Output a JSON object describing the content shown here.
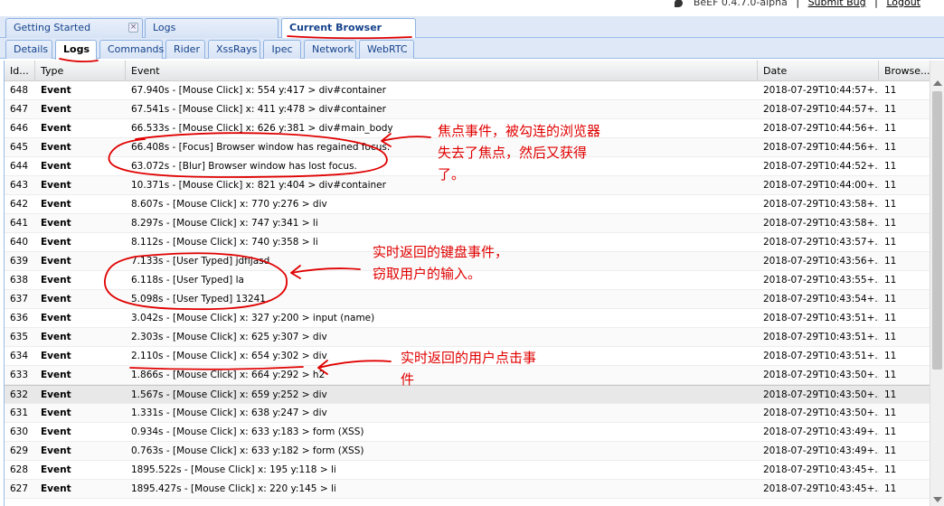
{
  "topbar": {
    "app_version": "BeEF  0.4.7.0-alpha",
    "submit_bug": "Submit  Bug",
    "logout": "Logout",
    "separator": "|"
  },
  "outer_tabs": [
    {
      "label": "Getting Started"
    },
    {
      "label": "Logs"
    },
    {
      "label": "Current Browser"
    }
  ],
  "inner_tabs": [
    {
      "label": "Details"
    },
    {
      "label": "Logs"
    },
    {
      "label": "Commands"
    },
    {
      "label": "Rider"
    },
    {
      "label": "XssRays"
    },
    {
      "label": "Ipec"
    },
    {
      "label": "Network"
    },
    {
      "label": "WebRTC"
    }
  ],
  "grid": {
    "columns": [
      "Id...",
      "Type",
      "Event",
      "Date",
      "Browse..."
    ],
    "rows": [
      [
        "648",
        "Event",
        "67.940s - [Mouse Click] x: 554 y:417 > div#container",
        "2018-07-29T10:44:57+...",
        "11"
      ],
      [
        "647",
        "Event",
        "67.541s - [Mouse Click] x: 411 y:478 > div#container",
        "2018-07-29T10:44:57+...",
        "11"
      ],
      [
        "646",
        "Event",
        "66.533s - [Mouse Click] x: 626 y:381 > div#main_body",
        "2018-07-29T10:44:56+...",
        "11"
      ],
      [
        "645",
        "Event",
        "66.408s - [Focus] Browser window has regained focus.",
        "2018-07-29T10:44:56+...",
        "11"
      ],
      [
        "644",
        "Event",
        "63.072s - [Blur] Browser window has lost focus.",
        "2018-07-29T10:44:52+...",
        "11"
      ],
      [
        "643",
        "Event",
        "10.371s - [Mouse Click] x: 821 y:404 > div#container",
        "2018-07-29T10:44:00+...",
        "11"
      ],
      [
        "642",
        "Event",
        "8.607s - [Mouse Click] x: 770 y:276 > div",
        "2018-07-29T10:43:58+...",
        "11"
      ],
      [
        "641",
        "Event",
        "8.297s - [Mouse Click] x: 747 y:341 > li",
        "2018-07-29T10:43:58+...",
        "11"
      ],
      [
        "640",
        "Event",
        "8.112s - [Mouse Click] x: 740 y:358 > li",
        "2018-07-29T10:43:57+...",
        "11"
      ],
      [
        "639",
        "Event",
        "7.133s - [User Typed] jdfljasd",
        "2018-07-29T10:43:56+...",
        "11"
      ],
      [
        "638",
        "Event",
        "6.118s - [User Typed] la",
        "2018-07-29T10:43:55+...",
        "11"
      ],
      [
        "637",
        "Event",
        "5.098s - [User Typed] 13241",
        "2018-07-29T10:43:54+...",
        "11"
      ],
      [
        "636",
        "Event",
        "3.042s - [Mouse Click] x: 327 y:200 > input (name)",
        "2018-07-29T10:43:51+...",
        "11"
      ],
      [
        "635",
        "Event",
        "2.303s - [Mouse Click] x: 625 y:307 > div",
        "2018-07-29T10:43:51+...",
        "11"
      ],
      [
        "634",
        "Event",
        "2.110s - [Mouse Click] x: 654 y:302 > div",
        "2018-07-29T10:43:51+...",
        "11"
      ],
      [
        "633",
        "Event",
        "1.866s - [Mouse Click] x: 664 y:292 > h2",
        "2018-07-29T10:43:50+...",
        "11"
      ],
      [
        "632",
        "Event",
        "1.567s - [Mouse Click] x: 659 y:252 > div",
        "2018-07-29T10:43:50+...",
        "11"
      ],
      [
        "631",
        "Event",
        "1.331s - [Mouse Click] x: 638 y:247 > div",
        "2018-07-29T10:43:50+...",
        "11"
      ],
      [
        "630",
        "Event",
        "0.934s - [Mouse Click] x: 633 y:183 > form (XSS)",
        "2018-07-29T10:43:49+...",
        "11"
      ],
      [
        "629",
        "Event",
        "0.763s - [Mouse Click] x: 633 y:182 > form (XSS)",
        "2018-07-29T10:43:49+...",
        "11"
      ],
      [
        "628",
        "Event",
        "1895.522s - [Mouse Click] x: 195 y:118 > li",
        "2018-07-29T10:43:45+...",
        "11"
      ],
      [
        "627",
        "Event",
        "1895.427s - [Mouse Click] x: 220 y:145 > li",
        "2018-07-29T10:43:45+...",
        "11"
      ]
    ],
    "selected_row": "632"
  },
  "annotations": {
    "focus_note_line1": "焦点事件，被勾连的浏览器",
    "focus_note_line2": "失去了焦点，然后又获得",
    "focus_note_line3": "了。",
    "keyboard_note_line1": "实时返回的键盘事件，",
    "keyboard_note_line2": "窃取用户的输入。",
    "click_note_line1": "实时返回的用户点击事",
    "click_note_line2": "件",
    "color": "#e00000"
  }
}
